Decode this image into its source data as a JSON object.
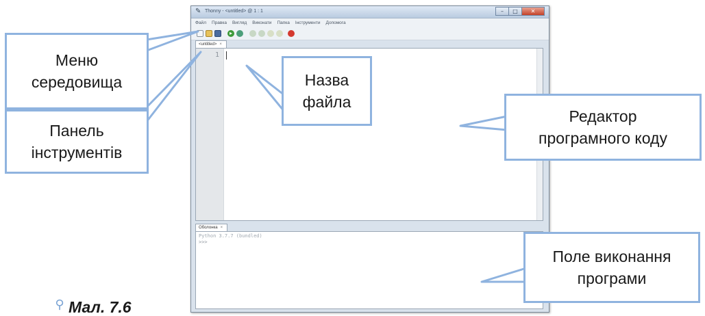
{
  "window": {
    "title": "Thonny - <untitled> @ 1 : 1",
    "icon": "thonny-icon",
    "controls": {
      "minimize": "–",
      "maximize": "□",
      "close": "✕"
    }
  },
  "menu": {
    "items": [
      "Файл",
      "Правка",
      "Вигляд",
      "Виконати",
      "Папка",
      "Інструменти",
      "Допомога"
    ]
  },
  "toolbar": {
    "icons": [
      "new-file-icon",
      "open-file-icon",
      "save-icon",
      "run-icon",
      "debug-icon",
      "step-over-icon",
      "step-into-icon",
      "step-out-icon",
      "resume-icon",
      "stop-icon"
    ]
  },
  "editor": {
    "tab_label": "<untitled>",
    "tab_close": "×",
    "line_number": "1"
  },
  "shell": {
    "tab_label": "Оболонка",
    "tab_close": "×",
    "banner": "Python 3.7.7 (bundled)",
    "prompt": ">>>"
  },
  "callouts": {
    "menu": [
      "Меню",
      "середовища"
    ],
    "toolbar": [
      "Панель",
      "інструментів"
    ],
    "filename": [
      "Назва",
      "файла"
    ],
    "editor": [
      "Редактор",
      "програмного коду"
    ],
    "shell": [
      "Поле виконання",
      "програми"
    ]
  },
  "caption": "Мал. 7.6",
  "colors": {
    "callout_border": "#8fb3df",
    "stop_button": "#d43a2f",
    "run_button": "#3d9a3a"
  }
}
